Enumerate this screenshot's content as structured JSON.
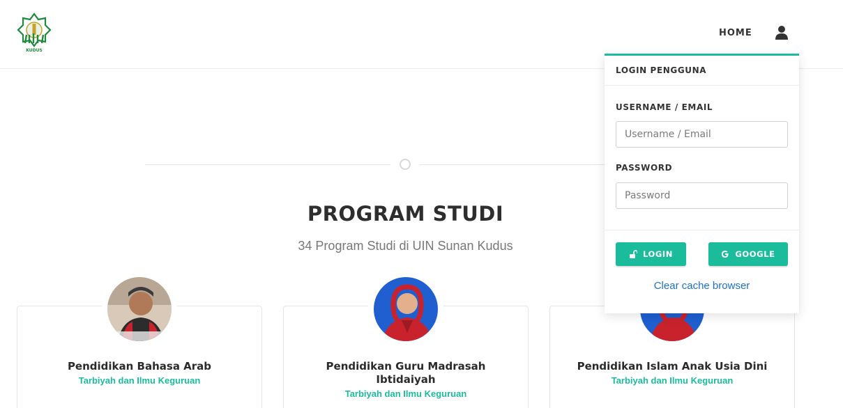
{
  "header": {
    "logo_icon": "uin-kudus-logo",
    "logo_text": "KUDUS",
    "nav_home": "HOME",
    "user_icon": "user-icon"
  },
  "section": {
    "title": "PROGRAM STUDI",
    "subtitle": "34 Program Studi di UIN Sunan Kudus"
  },
  "programs": [
    {
      "name_line1": "Pendidikan Bahasa Arab",
      "name_line2": "",
      "faculty": "Tarbiyah dan Ilmu Keguruan"
    },
    {
      "name_line1": "Pendidikan Guru Madrasah",
      "name_line2": "Ibtidaiyah",
      "faculty": "Tarbiyah dan Ilmu Keguruan"
    },
    {
      "name_line1": "Pendidikan Islam Anak Usia Dini",
      "name_line2": "",
      "faculty": "Tarbiyah dan Ilmu Keguruan"
    }
  ],
  "login": {
    "title": "LOGIN PENGGUNA",
    "username_label": "USERNAME / EMAIL",
    "username_placeholder": "Username / Email",
    "username_value": "",
    "password_label": "PASSWORD",
    "password_placeholder": "Password",
    "password_value": "",
    "login_button": "LOGIN",
    "login_icon": "unlock-icon",
    "google_button": "GOOGLE",
    "google_icon": "google-icon",
    "clear_cache": "Clear cache browser"
  },
  "colors": {
    "accent": "#1abc9c",
    "link": "#1a73c8",
    "logo_green": "#1f8a3c",
    "logo_gold": "#c9a227"
  }
}
